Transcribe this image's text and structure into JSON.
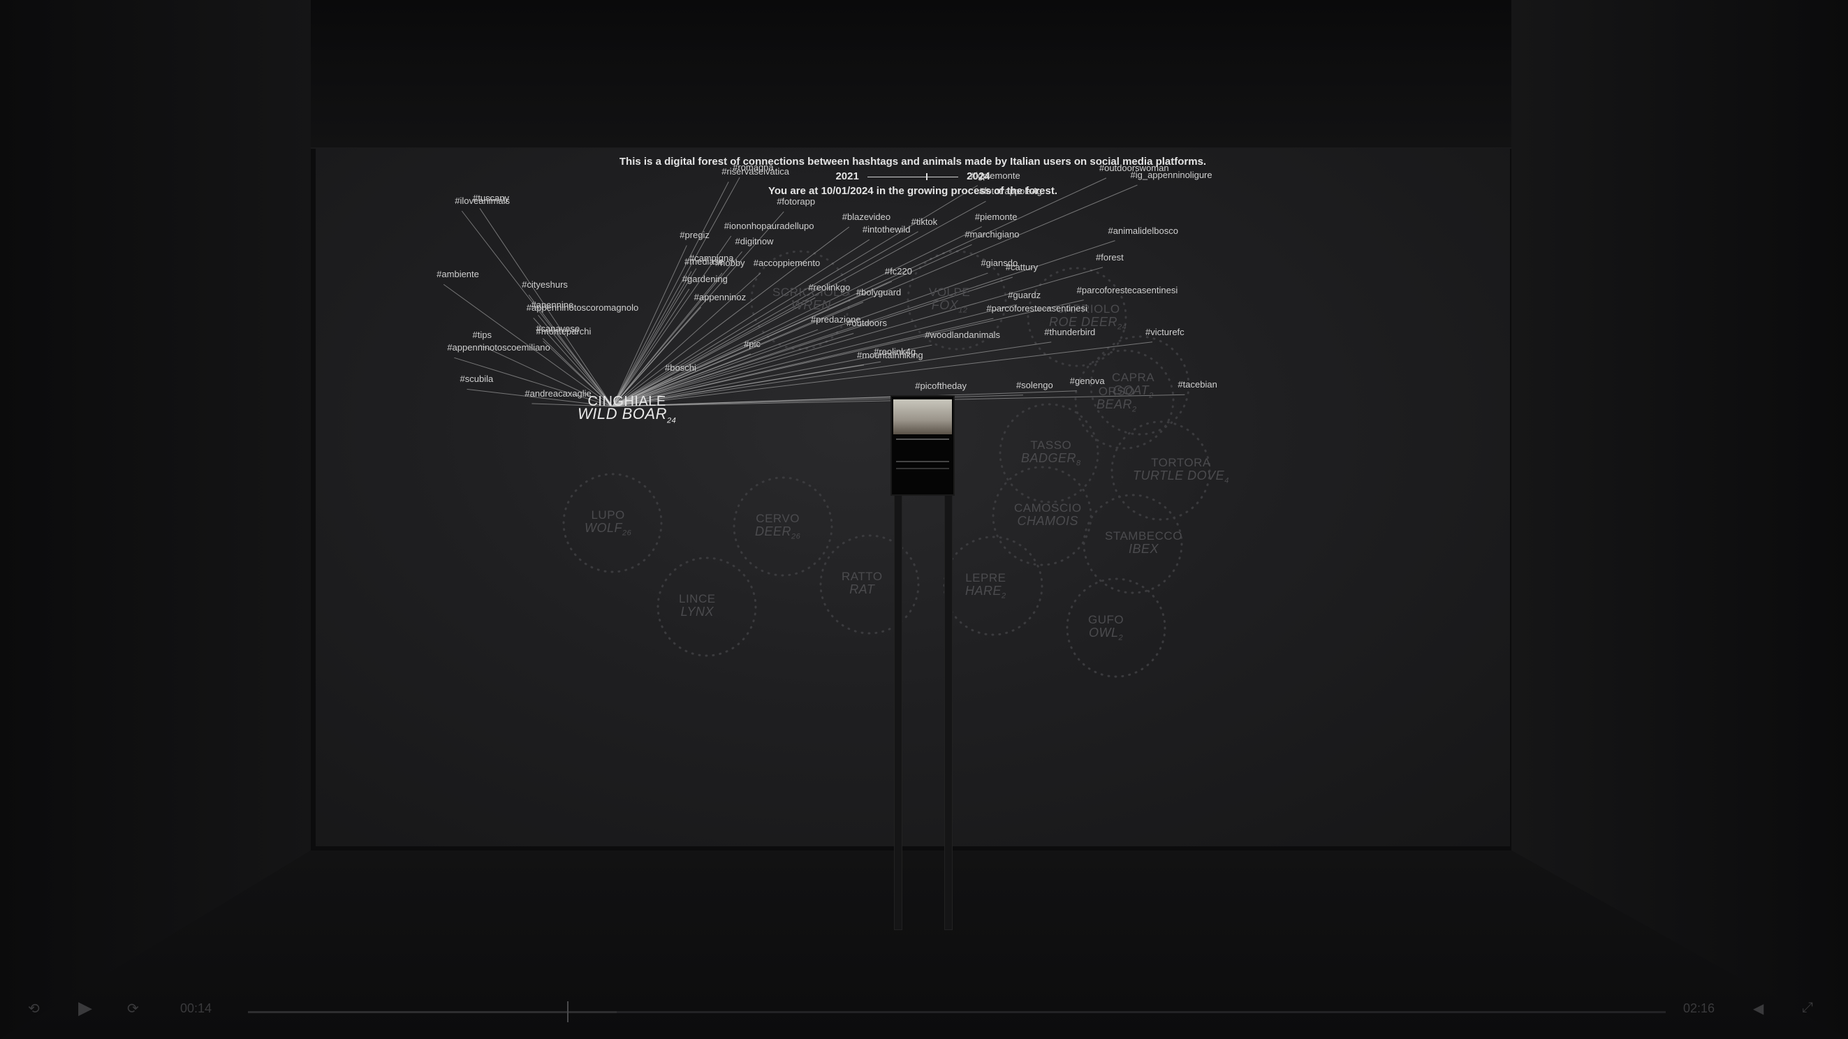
{
  "intro": {
    "line1": "This is a digital forest of connections between hashtags and animals made by Italian users on social media platforms.",
    "timeline_start": "2021",
    "timeline_end": "2024",
    "line3": "You are at 10/01/2024 in the growing process of the forest."
  },
  "hubs": [
    {
      "id": "wildboar",
      "it": "CINGHIALE",
      "en": "WILD BOAR",
      "count": "24",
      "state": "active"
    },
    {
      "id": "wren",
      "it": "SCRICCIOLO",
      "en": "WREN",
      "count": "",
      "state": "dim"
    },
    {
      "id": "fox",
      "it": "VOLPE",
      "en": "FOX",
      "count": "12",
      "state": "dim"
    },
    {
      "id": "roedeer",
      "it": "CAPRIOLO",
      "en": "ROE DEER",
      "count": "24",
      "state": "dim"
    },
    {
      "id": "goat",
      "it": "CAPRA",
      "en": "GOAT",
      "count": "2",
      "state": "dim"
    },
    {
      "id": "bear",
      "it": "ORSO",
      "en": "BEAR",
      "count": "2",
      "state": "dim"
    },
    {
      "id": "badger",
      "it": "TASSO",
      "en": "BADGER",
      "count": "8",
      "state": "dim"
    },
    {
      "id": "turtledove",
      "it": "TORTORA",
      "en": "TURTLE DOVE",
      "count": "4",
      "state": "dim"
    },
    {
      "id": "chamois",
      "it": "CAMOSCIO",
      "en": "CHAMOIS",
      "count": "",
      "state": "dim"
    },
    {
      "id": "ibex",
      "it": "STAMBECCO",
      "en": "IBEX",
      "count": "",
      "state": "dim"
    },
    {
      "id": "hare",
      "it": "LEPRE",
      "en": "HARE",
      "count": "2",
      "state": "dim"
    },
    {
      "id": "rat",
      "it": "RATTO",
      "en": "RAT",
      "count": "",
      "state": "dim"
    },
    {
      "id": "wolf",
      "it": "LUPO",
      "en": "WOLF",
      "count": "26",
      "state": "dim"
    },
    {
      "id": "deer",
      "it": "CERVO",
      "en": "DEER",
      "count": "26",
      "state": "dim"
    },
    {
      "id": "lynx",
      "it": "LINCE",
      "en": "LYNX",
      "count": "",
      "state": "dim"
    },
    {
      "id": "owl",
      "it": "GUFO",
      "en": "OWL",
      "count": "2",
      "state": "dim"
    }
  ],
  "hashtags": [
    "#iloveanimals",
    "#reolink4g",
    "#reolinkgo",
    "#ig_appenninoligure",
    "#fototrappola4g",
    "#appenninotoscoromagnolo",
    "#solengo",
    "#hobby",
    "#outdoorswoman",
    "#gardening",
    "#ambiente",
    "#thunderbird",
    "#parcoforestecasentinesi",
    "#riservaselvatica",
    "#mediase",
    "#tips",
    "#tiktok",
    "#fc220",
    "#digitnow",
    "#boschi",
    "#apennine",
    "#giansdo",
    "#genova",
    "#accoppiemento",
    "#pic",
    "#scubila",
    "#tacebian",
    "#campigna",
    "#parcoforestecasentinesi",
    "#bolyguard",
    "#tuscany",
    "#forest",
    "#picoftheday",
    "#romagna",
    "#mountainhiking",
    "#appenninotoscoemiliano",
    "#victurefc",
    "#iononhopauradellupo",
    "#guardz",
    "#blazevideo",
    "#cityeshurs",
    "#cattury",
    "#appenninoz",
    "#pregiz",
    "#fotorapp",
    "#andreacaxaglie",
    "#predazione",
    "#outdoors",
    "#intothewild",
    "#piemonte",
    "#canavese",
    "#woodlandanimals",
    "#igpiemonte",
    "#marchigiano",
    "#animalidelbosco",
    "#monteparchi"
  ],
  "controls": {
    "elapsed": "00:14",
    "total": "02:16",
    "progress": 0.26
  }
}
